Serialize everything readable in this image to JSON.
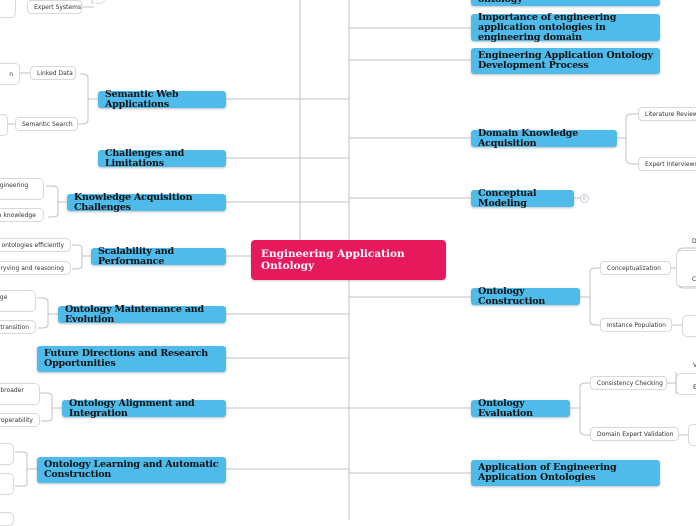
{
  "central": {
    "title": "Engineering Application Ontology"
  },
  "right_topics": [
    {
      "label": "ontology"
    },
    {
      "label": "Importance of engineering application ontologies in engineering domain"
    },
    {
      "label": "Engineering Application Ontology Development Process"
    },
    {
      "label": "Domain Knowledge Acquisition",
      "children": [
        "Literature Review",
        "Expert Interviews"
      ]
    },
    {
      "label": "Conceptual Modeling",
      "collapsed_count": "6"
    },
    {
      "label": "Ontology Construction",
      "children": [
        "Conceptualization",
        "Instance Population"
      ],
      "grandchildren_partial": [
        "D",
        "C"
      ]
    },
    {
      "label": "Ontology Evaluation",
      "children": [
        "Consistency Checking",
        "Domain Expert Validation"
      ],
      "grandchildren_partial": [
        "V",
        "E"
      ]
    },
    {
      "label": "Application of Engineering Application Ontologies"
    }
  ],
  "left_topics": [
    {
      "label": "Expert Systems"
    },
    {
      "label": "Semantic Web Applications",
      "children": [
        "Linked Data",
        "Semantic Search"
      ],
      "grandchildren_partial": [
        "n"
      ]
    },
    {
      "label": "Challenges and Limitations"
    },
    {
      "label": "Knowledge Acquisition Challenges",
      "children": [
        "ngineering",
        "in knowledge"
      ]
    },
    {
      "label": "Scalability and Performance",
      "children": [
        "ontologies efficiently",
        "ueryving and reasoning"
      ]
    },
    {
      "label": "Ontology Maintenance and Evolution",
      "children": [
        "dge",
        "transition"
      ]
    },
    {
      "label": "Future Directions and Research Opportunities"
    },
    {
      "label": "Ontology Alignment and Integration",
      "children": [
        "r broader",
        "roperability"
      ]
    },
    {
      "label": "Ontology Learning and Automatic Construction"
    }
  ],
  "colors": {
    "central": "#e5195c",
    "main_topic": "#4fbbeb",
    "line": "#bdbdbd"
  }
}
